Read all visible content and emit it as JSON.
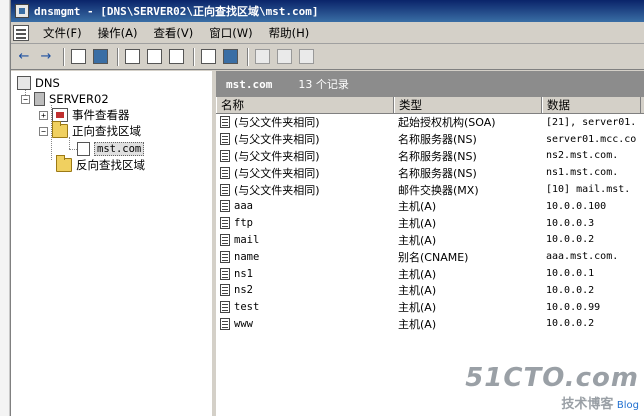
{
  "window": {
    "title": "dnsmgmt - [DNS\\SERVER02\\正向查找区域\\mst.com]"
  },
  "menu": [
    "文件(F)",
    "操作(A)",
    "查看(V)",
    "窗口(W)",
    "帮助(H)"
  ],
  "tree": {
    "root": "DNS",
    "server": "SERVER02",
    "event_viewer": "事件查看器",
    "forward_zones": "正向查找区域",
    "zone": "mst.com",
    "reverse_zones": "反向查找区域"
  },
  "panel": {
    "zone_name": "mst.com",
    "record_count": "13 个记录"
  },
  "columns": [
    "名称",
    "类型",
    "数据"
  ],
  "records": [
    {
      "name": "(与父文件夹相同)",
      "type": "起始授权机构(SOA)",
      "data": "[21], server01."
    },
    {
      "name": "(与父文件夹相同)",
      "type": "名称服务器(NS)",
      "data": "server01.mcc.co"
    },
    {
      "name": "(与父文件夹相同)",
      "type": "名称服务器(NS)",
      "data": "ns2.mst.com."
    },
    {
      "name": "(与父文件夹相同)",
      "type": "名称服务器(NS)",
      "data": "ns1.mst.com."
    },
    {
      "name": "(与父文件夹相同)",
      "type": "邮件交换器(MX)",
      "data": "[10]  mail.mst."
    },
    {
      "name": "aaa",
      "type": "主机(A)",
      "data": "10.0.0.100"
    },
    {
      "name": "ftp",
      "type": "主机(A)",
      "data": "10.0.0.3"
    },
    {
      "name": "mail",
      "type": "主机(A)",
      "data": "10.0.0.2"
    },
    {
      "name": "name",
      "type": "别名(CNAME)",
      "data": "aaa.mst.com."
    },
    {
      "name": "ns1",
      "type": "主机(A)",
      "data": "10.0.0.1"
    },
    {
      "name": "ns2",
      "type": "主机(A)",
      "data": "10.0.0.2"
    },
    {
      "name": "test",
      "type": "主机(A)",
      "data": "10.0.0.99"
    },
    {
      "name": "www",
      "type": "主机(A)",
      "data": "10.0.0.2"
    }
  ],
  "watermark": {
    "big": "51CTO.com",
    "sub": "技术博客",
    "small": "Blog"
  }
}
